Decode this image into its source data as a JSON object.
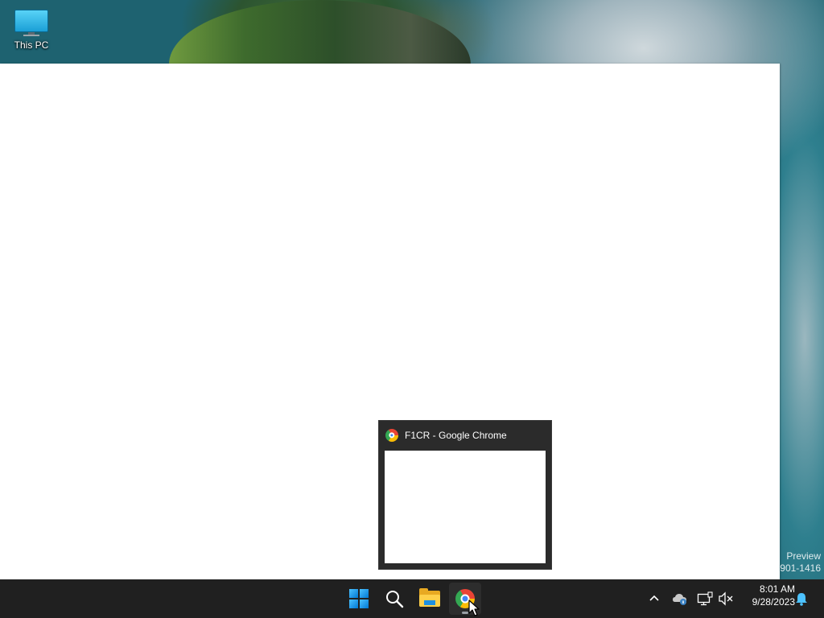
{
  "desktop": {
    "icons": [
      {
        "label": "This PC",
        "icon": "monitor-icon"
      }
    ]
  },
  "watermark": {
    "line1": "Preview",
    "line2": "901-1416"
  },
  "taskbar": {
    "apps": [
      {
        "name": "Start",
        "icon": "windows-start-icon"
      },
      {
        "name": "Search",
        "icon": "search-icon"
      },
      {
        "name": "File Explorer",
        "icon": "folder-icon"
      },
      {
        "name": "Google Chrome",
        "icon": "chrome-icon",
        "running": true,
        "hovered": true
      }
    ],
    "tray": {
      "icons": [
        "chevron-up-icon",
        "onedrive-icon",
        "network-icon",
        "volume-muted-icon",
        "notification-bell-icon"
      ],
      "time": "8:01 AM",
      "date": "9/28/2023"
    }
  },
  "thumbnail": {
    "title": "F1CR - Google Chrome"
  },
  "colors": {
    "taskbar": "#202020",
    "popup": "#2b2b2b",
    "accent": "#0078d4",
    "bell": "#4cc2ff"
  }
}
